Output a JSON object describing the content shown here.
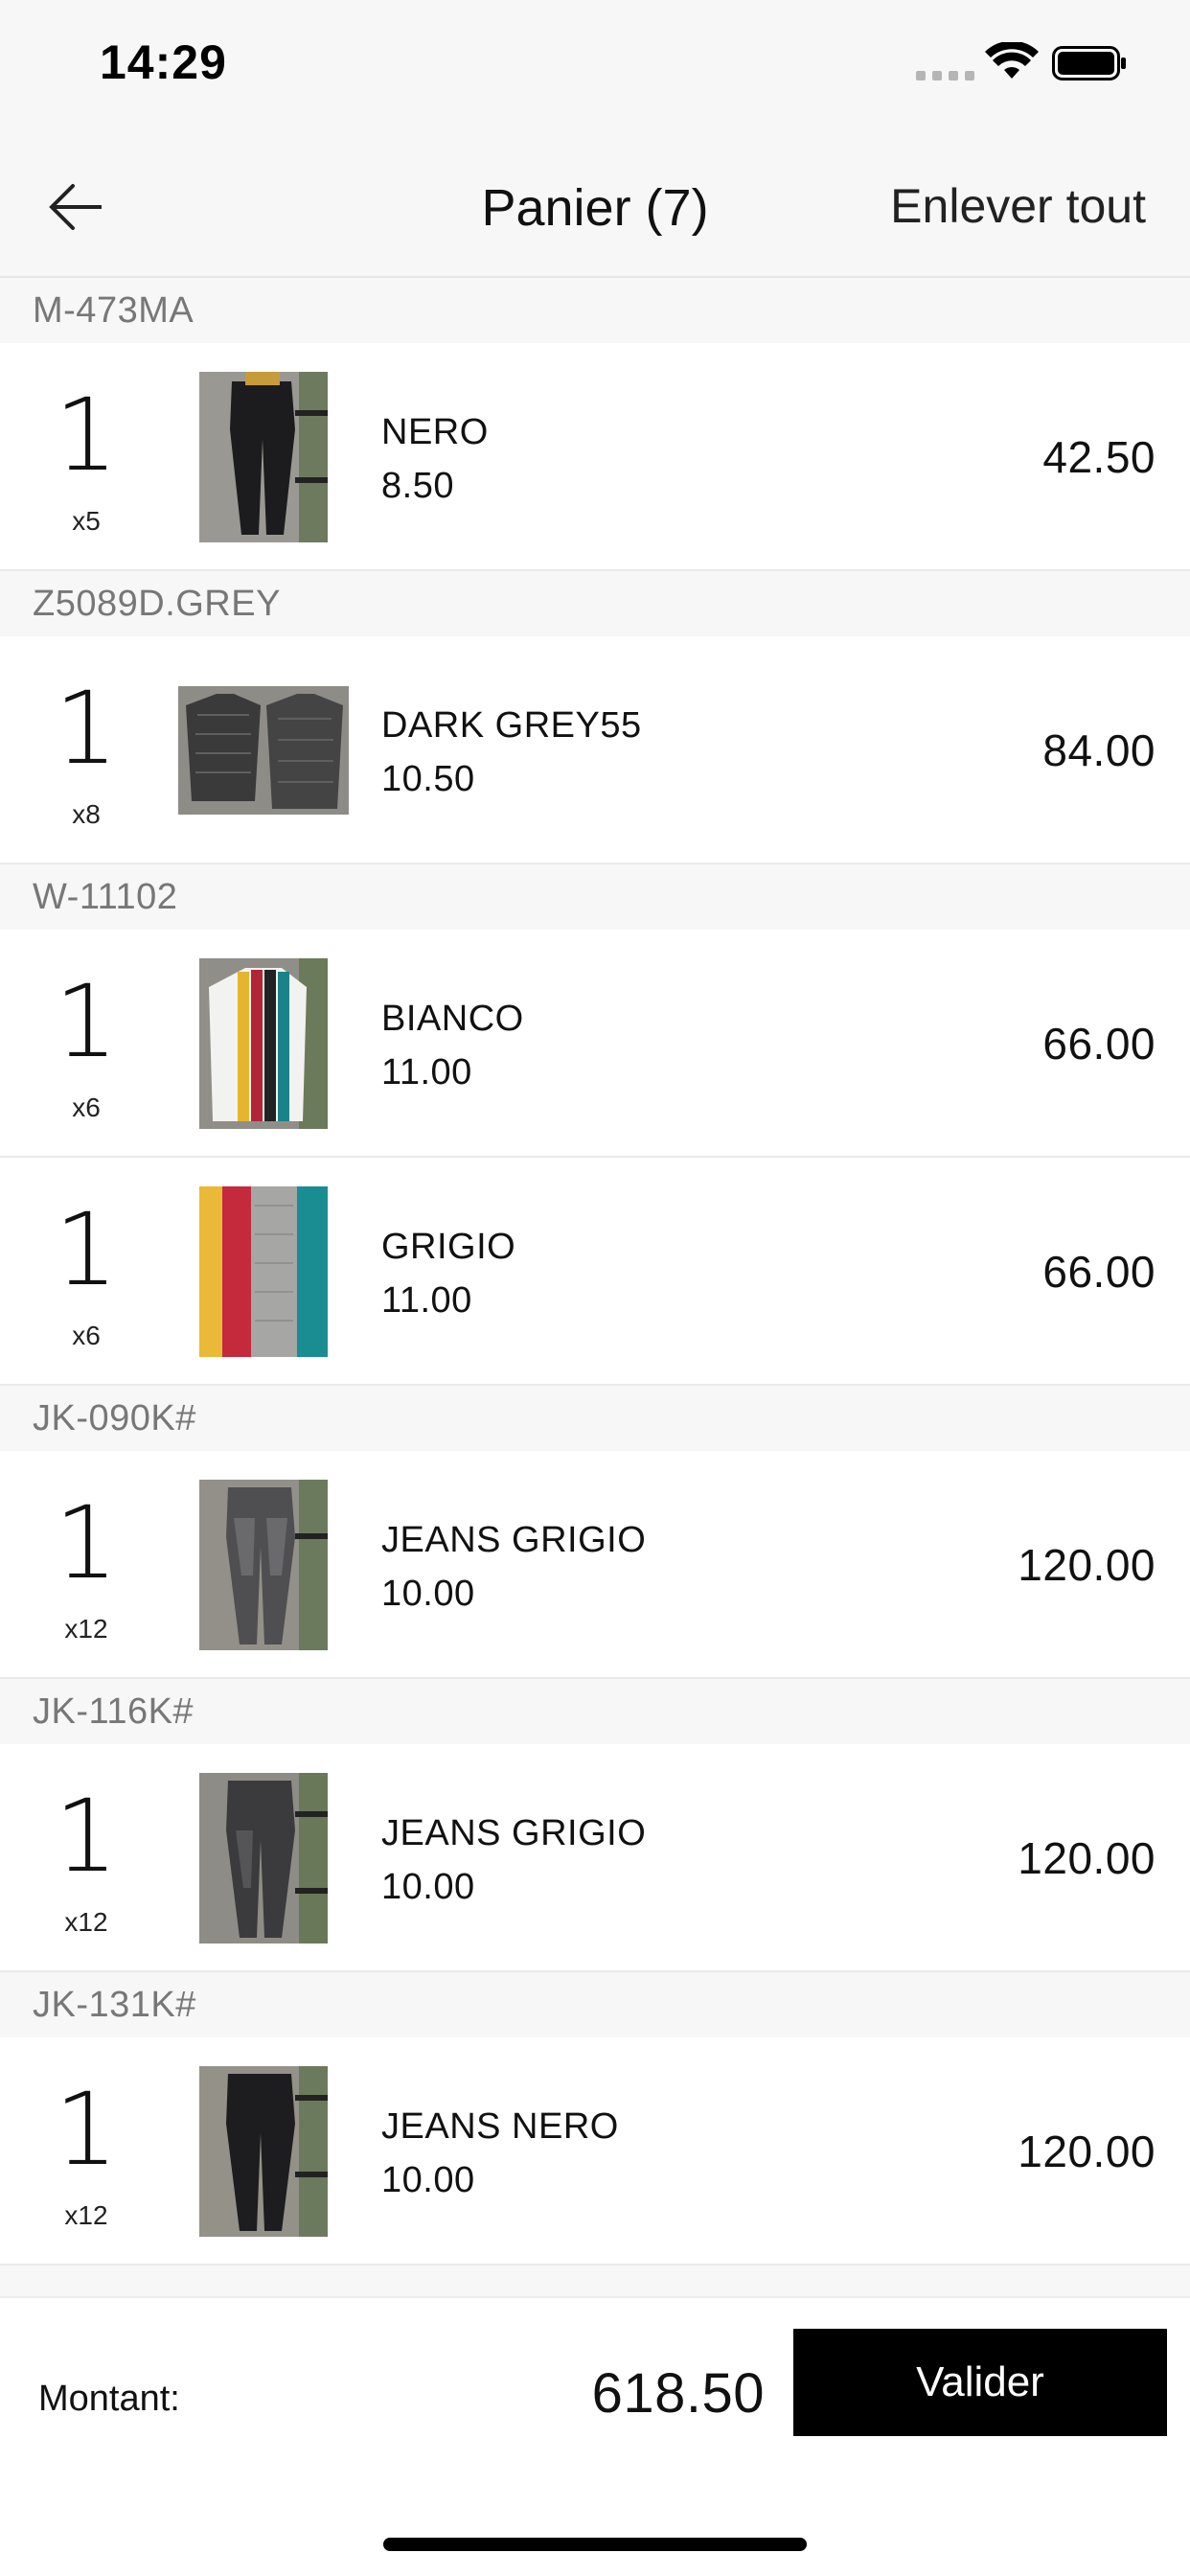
{
  "status_bar": {
    "time": "14:29"
  },
  "nav": {
    "title": "Panier (7)",
    "remove_all_label": "Enlever tout"
  },
  "sections": [
    {
      "code": "M-473MA",
      "items": [
        {
          "qty": "1",
          "multiplier": "x5",
          "name": "NERO",
          "unit_price": "8.50",
          "total": "42.50",
          "thumb": "dark-pants"
        }
      ]
    },
    {
      "code": "Z5089D.GREY",
      "items": [
        {
          "qty": "1",
          "multiplier": "x8",
          "name": "DARK GREY55",
          "unit_price": "10.50",
          "total": "84.00",
          "thumb": "grey-knit-sweater"
        }
      ]
    },
    {
      "code": "W-11102",
      "items": [
        {
          "qty": "1",
          "multiplier": "x6",
          "name": "BIANCO",
          "unit_price": "11.00",
          "total": "66.00",
          "thumb": "white-striped-sweater"
        },
        {
          "qty": "1",
          "multiplier": "x6",
          "name": "GRIGIO",
          "unit_price": "11.00",
          "total": "66.00",
          "thumb": "grey-striped-sweater"
        }
      ]
    },
    {
      "code": "JK-090K#",
      "items": [
        {
          "qty": "1",
          "multiplier": "x12",
          "name": "JEANS GRIGIO",
          "unit_price": "10.00",
          "total": "120.00",
          "thumb": "grey-jeans"
        }
      ]
    },
    {
      "code": "JK-116K#",
      "items": [
        {
          "qty": "1",
          "multiplier": "x12",
          "name": "JEANS GRIGIO",
          "unit_price": "10.00",
          "total": "120.00",
          "thumb": "grey-jeans"
        }
      ]
    },
    {
      "code": "JK-131K#",
      "items": [
        {
          "qty": "1",
          "multiplier": "x12",
          "name": "JEANS NERO",
          "unit_price": "10.00",
          "total": "120.00",
          "thumb": "black-jeans"
        }
      ]
    }
  ],
  "footer": {
    "amount_label": "Montant:",
    "amount_value": "618.50",
    "validate_label": "Valider"
  },
  "colors": {
    "background": "#ffffff",
    "section_bg": "#f7f7f7",
    "primary_button": "#000000"
  }
}
